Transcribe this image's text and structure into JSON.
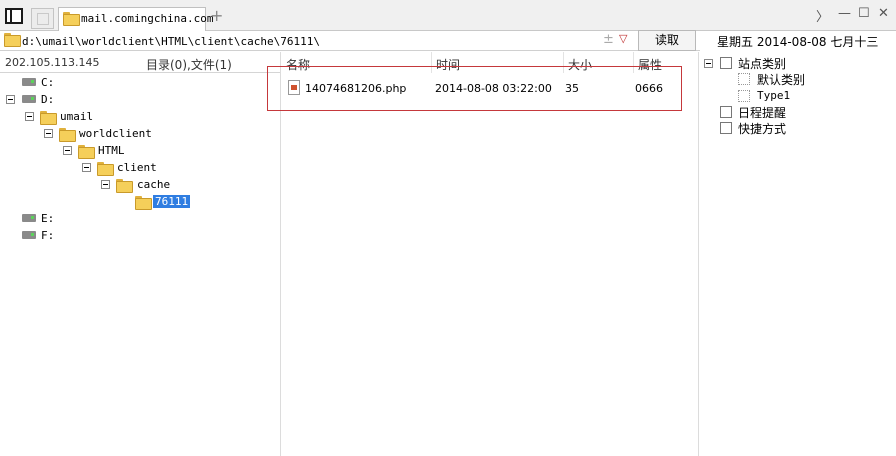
{
  "tabs": {
    "active_tab_label": "mail.comingchina.com",
    "new_tab_symbol": "+"
  },
  "window": {
    "forward_symbol": "〉",
    "minimize_symbol": "—",
    "maximize_symbol": "☐",
    "close_symbol": "✕"
  },
  "address": {
    "path": "d:\\umail\\worldclient\\HTML\\client\\cache\\76111\\",
    "pin_symbol": "±",
    "dropdown_symbol": "▽",
    "read_button_label": "读取"
  },
  "date_display": "星期五 2014-08-08 七月十三",
  "left_panel": {
    "ip": "202.105.113.145",
    "summary": "目录(0),文件(1)",
    "tree": [
      {
        "label": "C:",
        "type": "drive"
      },
      {
        "label": "D:",
        "type": "drive"
      },
      {
        "label": "umail",
        "type": "folder"
      },
      {
        "label": "worldclient",
        "type": "folder"
      },
      {
        "label": "HTML",
        "type": "folder"
      },
      {
        "label": "client",
        "type": "folder"
      },
      {
        "label": "cache",
        "type": "folder"
      },
      {
        "label": "76111",
        "type": "folder-open",
        "selected": true
      },
      {
        "label": "E:",
        "type": "drive"
      },
      {
        "label": "F:",
        "type": "drive"
      }
    ]
  },
  "file_list": {
    "columns": [
      "名称",
      "时间",
      "大小",
      "属性"
    ],
    "rows": [
      {
        "name": "14074681206.php",
        "time": "2014-08-08 03:22:00",
        "size": "35",
        "attr": "0666"
      }
    ]
  },
  "right_panel": {
    "items": [
      {
        "label": "站点类别"
      },
      {
        "label": "默认类别"
      },
      {
        "label": "Type1"
      },
      {
        "label": "日程提醒"
      },
      {
        "label": "快捷方式"
      }
    ]
  },
  "colors": {
    "selection": "#2f7de1",
    "highlight_border": "#c5383b",
    "folder_yellow": "#f5cf5a"
  }
}
